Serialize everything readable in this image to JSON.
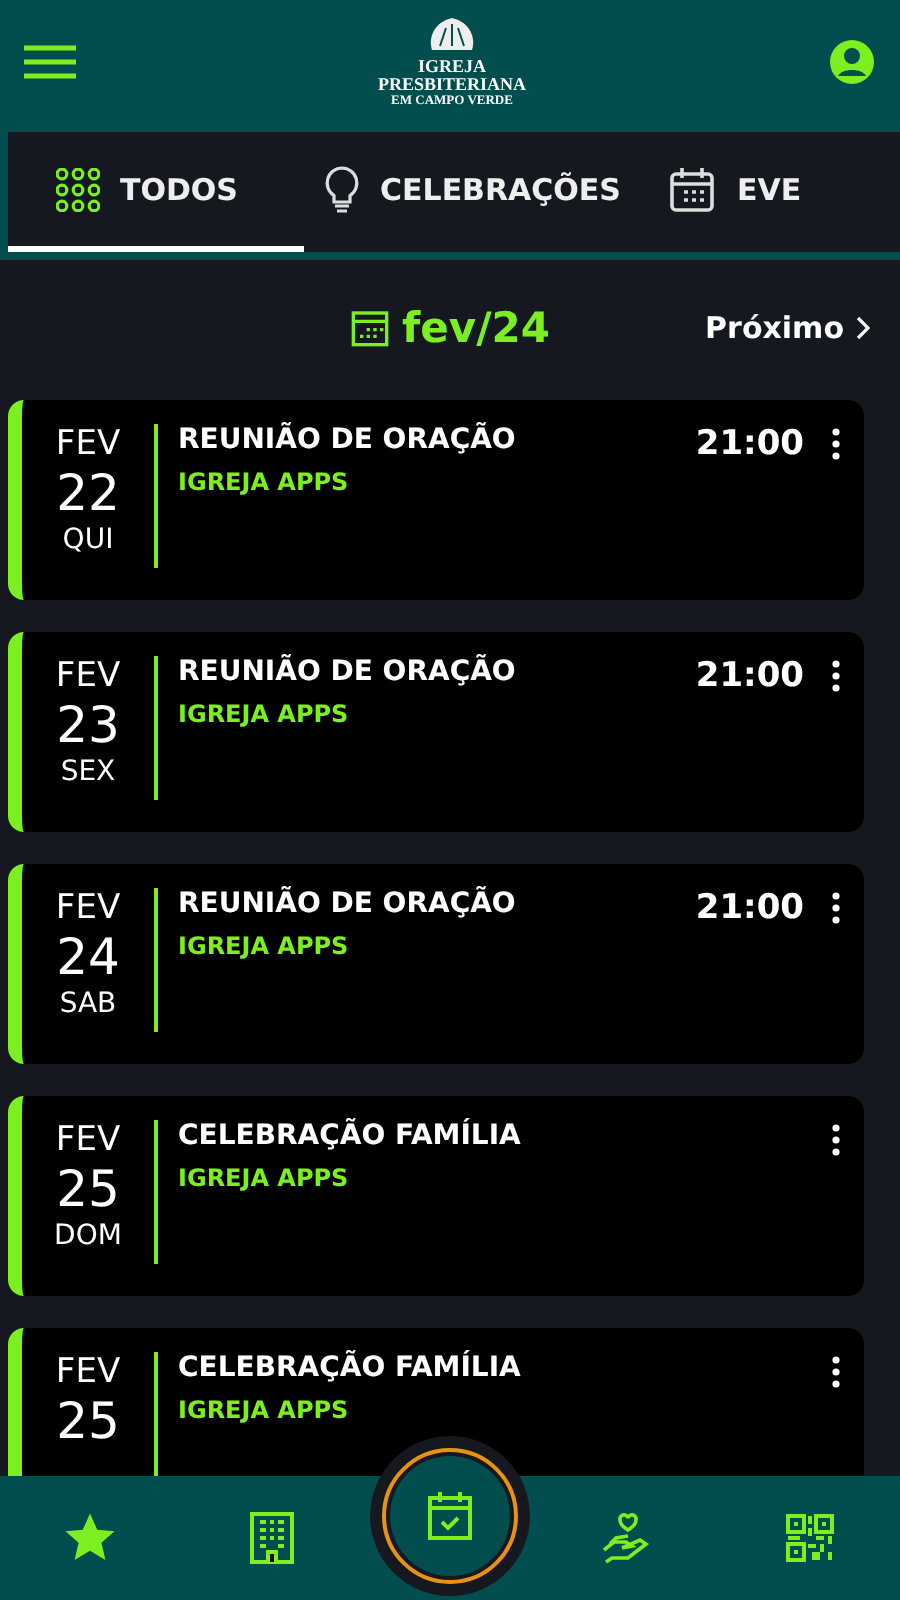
{
  "header": {
    "logo_lines": [
      "IGREJA",
      "PRESBITERIANA",
      "EM CAMPO VERDE"
    ]
  },
  "tabs": [
    {
      "label": "TODOS",
      "kind": "grid",
      "selected": true
    },
    {
      "label": "CELEBRAÇÕES",
      "kind": "bulb",
      "selected": false
    },
    {
      "label": "EVE",
      "kind": "calendar",
      "selected": false
    }
  ],
  "month": {
    "label": "fev/24",
    "next": "Próximo"
  },
  "events": [
    {
      "month": "FEV",
      "day": "22",
      "weekday": "QUI",
      "title": "REUNIÃO DE ORAÇÃO",
      "church": "IGREJA APPS",
      "time": "21:00"
    },
    {
      "month": "FEV",
      "day": "23",
      "weekday": "SEX",
      "title": "REUNIÃO DE ORAÇÃO",
      "church": "IGREJA APPS",
      "time": "21:00"
    },
    {
      "month": "FEV",
      "day": "24",
      "weekday": "SAB",
      "title": "REUNIÃO DE ORAÇÃO",
      "church": "IGREJA APPS",
      "time": "21:00"
    },
    {
      "month": "FEV",
      "day": "25",
      "weekday": "DOM",
      "title": "CELEBRAÇÃO FAMÍLIA",
      "church": "IGREJA APPS"
    },
    {
      "month": "FEV",
      "day": "25",
      "title": "CELEBRAÇÃO FAMÍLIA",
      "church": "IGREJA APPS"
    }
  ],
  "nav": [
    {
      "kind": "star",
      "selected": false
    },
    {
      "kind": "building",
      "selected": false
    },
    {
      "kind": "calendar",
      "selected": true
    },
    {
      "kind": "donate",
      "selected": false
    },
    {
      "kind": "qr",
      "selected": false
    }
  ]
}
